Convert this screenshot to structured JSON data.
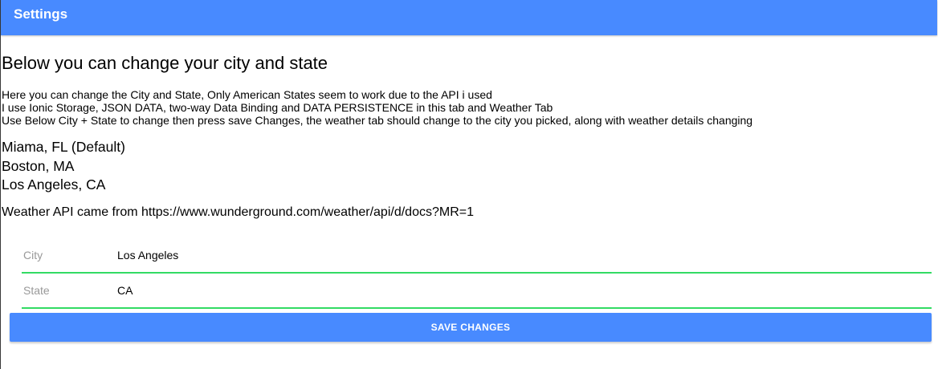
{
  "toolbar": {
    "title": "Settings"
  },
  "main": {
    "heading": "Below you can change your city and state",
    "info_lines": [
      "Here you can change the City and State, Only American States seem to work due to the API i used",
      "I use Ionic Storage, JSON DATA, two-way Data Binding and DATA PERSISTENCE in this tab and Weather Tab",
      "Use Below City + State to change then press save Changes, the weather tab should change to the city you picked, along with weather details changing"
    ],
    "cities": [
      "Miama, FL (Default)",
      "Boston, MA",
      "Los Angeles, CA"
    ],
    "api_note": "Weather API came from https://www.wunderground.com/weather/api/d/docs?MR=1"
  },
  "form": {
    "city": {
      "label": "City",
      "value": "Los Angeles"
    },
    "state": {
      "label": "State",
      "value": "CA"
    },
    "save_label": "SAVE CHANGES"
  },
  "colors": {
    "primary": "#488aff",
    "input_underline": "#32db64",
    "label_gray": "#999999"
  }
}
